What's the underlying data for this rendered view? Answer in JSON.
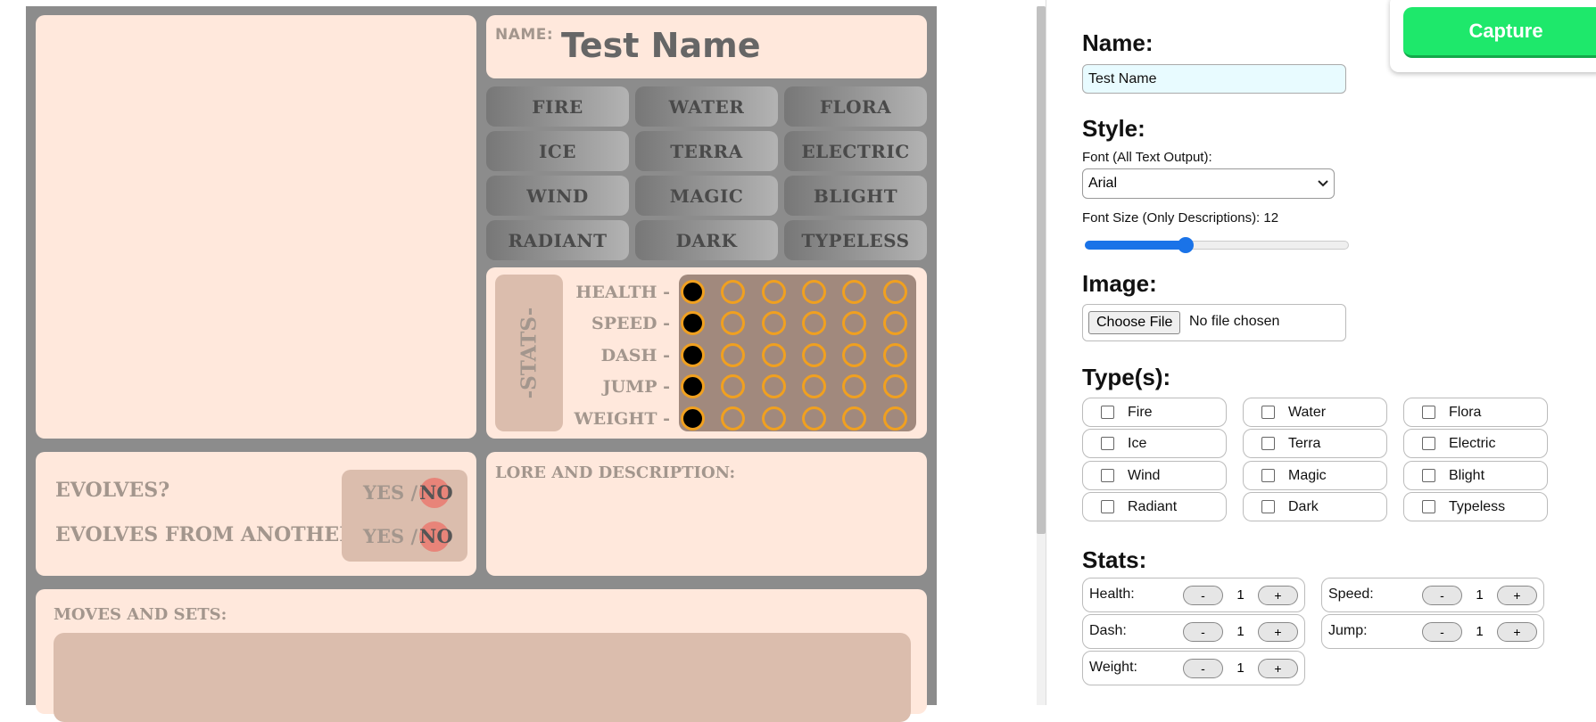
{
  "card": {
    "name_label": "NAME:",
    "name_value": "Test Name",
    "types": [
      "FIRE",
      "WATER",
      "FLORA",
      "ICE",
      "TERRA",
      "ELECTRIC",
      "WIND",
      "MAGIC",
      "BLIGHT",
      "RADIANT",
      "DARK",
      "TYPELESS"
    ],
    "stats_title": "-STATS-",
    "stats": [
      {
        "label": "HEALTH -",
        "value": 1
      },
      {
        "label": "SPEED -",
        "value": 1
      },
      {
        "label": "DASH -",
        "value": 1
      },
      {
        "label": "JUMP -",
        "value": 1
      },
      {
        "label": "WEIGHT -",
        "value": 1
      }
    ],
    "stat_max": 6,
    "evolves_label": "EVOLVES?",
    "evolves_from_label": "EVOLVES FROM ANOTHER?",
    "yes_text": "YES /",
    "no_text": "NO",
    "lore_label": "LORE AND DESCRIPTION:",
    "moves_label": "MOVES AND SETS:"
  },
  "form": {
    "name_heading": "Name:",
    "name_value": "Test Name",
    "style_heading": "Style:",
    "font_label": "Font (All Text Output):",
    "font_value": "Arial",
    "font_size_label": "Font Size (Only Descriptions): 12",
    "font_size_value": 12,
    "image_heading": "Image:",
    "file_button": "Choose File",
    "file_status": "No file chosen",
    "types_heading": "Type(s):",
    "type_options": [
      "Fire",
      "Water",
      "Flora",
      "Ice",
      "Terra",
      "Electric",
      "Wind",
      "Magic",
      "Blight",
      "Radiant",
      "Dark",
      "Typeless"
    ],
    "stats_heading": "Stats:",
    "stat_rows": [
      {
        "label": "Health:",
        "value": "1"
      },
      {
        "label": "Speed:",
        "value": "1"
      },
      {
        "label": "Dash:",
        "value": "1"
      },
      {
        "label": "Jump:",
        "value": "1"
      },
      {
        "label": "Weight:",
        "value": "1"
      }
    ],
    "minus": "-",
    "plus": "+",
    "capture_label": "Capture"
  },
  "colors": {
    "card_bg": "#8c8c8c",
    "panel_bg": "#ffe8dc",
    "dot_ring": "#f0a020",
    "no_badge": "#e88479",
    "capture_green": "#1ee86b",
    "slider_blue": "#1a73e8"
  }
}
